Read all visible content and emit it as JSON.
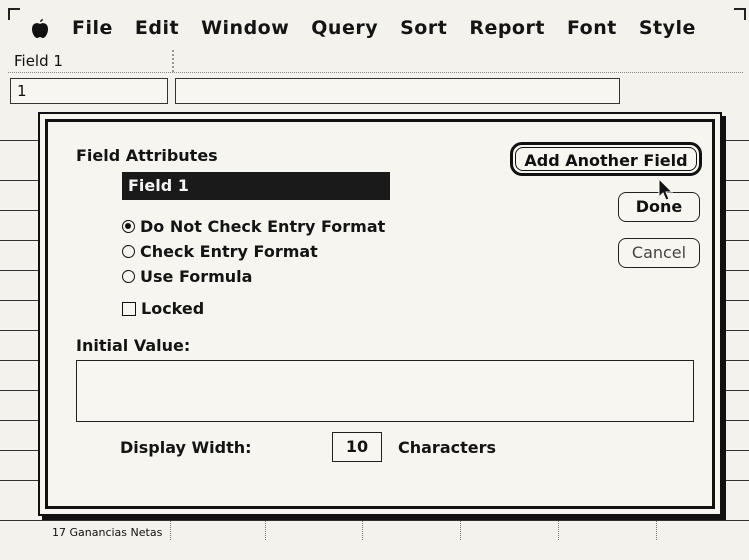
{
  "menubar": {
    "apple_icon": "apple-menu-icon",
    "items": [
      "File",
      "Edit",
      "Window",
      "Query",
      "Sort",
      "Report",
      "Font",
      "Style"
    ]
  },
  "background": {
    "column_header": "Field 1",
    "entry_value": "1",
    "row_number": "17",
    "row_text": "Ganancias Netas"
  },
  "dialog": {
    "title": "Field Attributes",
    "field_name": "Field 1",
    "radio_options": [
      {
        "label": "Do Not Check Entry Format",
        "selected": true
      },
      {
        "label": "Check Entry Format",
        "selected": false
      },
      {
        "label": "Use Formula",
        "selected": false
      }
    ],
    "locked_label": "Locked",
    "locked_checked": false,
    "initial_value_label": "Initial Value:",
    "initial_value": "",
    "display_width_label": "Display Width:",
    "display_width_value": "10",
    "characters_label": "Characters",
    "buttons": {
      "add_another": "Add Another Field",
      "done": "Done",
      "cancel": "Cancel"
    }
  },
  "colors": {
    "screen": "#f4f2ec",
    "ink": "#111111",
    "highlight_bg": "#1a1a1a",
    "highlight_text": "#f4f4f4"
  }
}
